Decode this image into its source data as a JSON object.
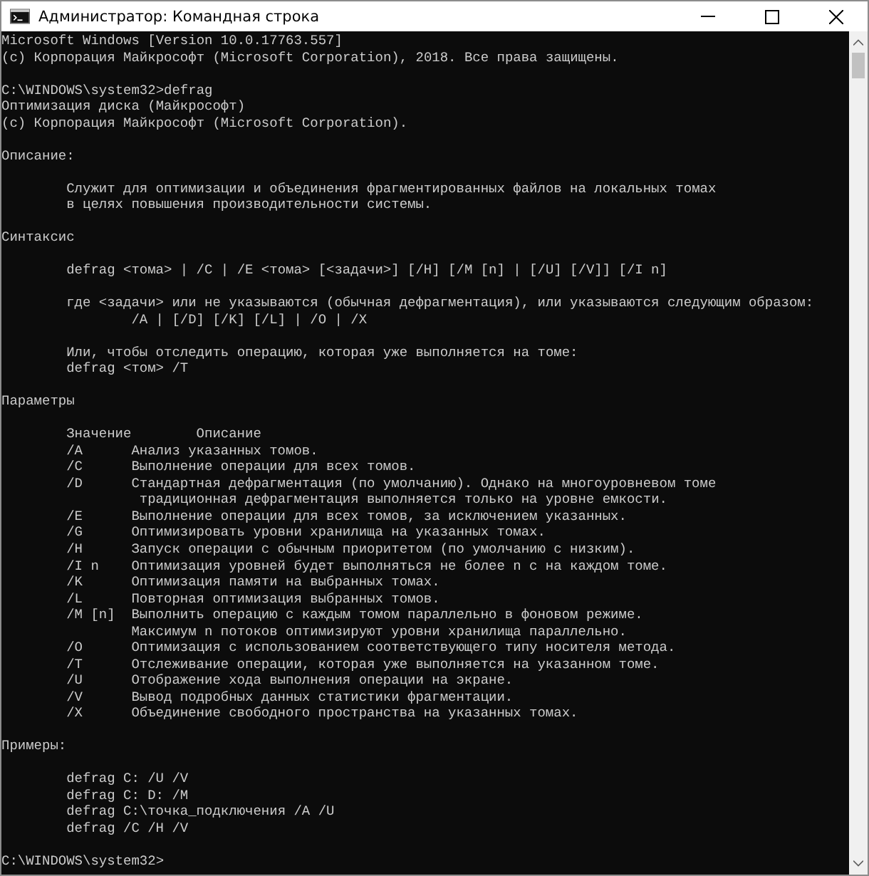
{
  "window": {
    "title": "Администратор: Командная строка",
    "buttons": [
      {
        "kind": "minimize"
      },
      {
        "kind": "maximize"
      },
      {
        "kind": "close"
      }
    ]
  },
  "console": {
    "lines": [
      {
        "kind": "line",
        "text": "Microsoft Windows [Version 10.0.17763.557]"
      },
      {
        "kind": "line",
        "text": "(c) Корпорация Майкрософт (Microsoft Corporation), 2018. Все права защищены."
      },
      {
        "kind": "blank"
      },
      {
        "kind": "line",
        "text": "C:\\WINDOWS\\system32>defrag"
      },
      {
        "kind": "line",
        "text": "Оптимизация диска (Майкрософт)"
      },
      {
        "kind": "line",
        "text": "(c) Корпорация Майкрософт (Microsoft Corporation)."
      },
      {
        "kind": "blank"
      },
      {
        "kind": "line",
        "text": "Описание:"
      },
      {
        "kind": "blank"
      },
      {
        "kind": "indent",
        "text": "Служит для оптимизации и объединения фрагментированных файлов на локальных томах"
      },
      {
        "kind": "indent",
        "text": "в целях повышения производительности системы."
      },
      {
        "kind": "blank"
      },
      {
        "kind": "line",
        "text": "Синтаксис"
      },
      {
        "kind": "blank"
      },
      {
        "kind": "indent",
        "text": "defrag <тома> | /C | /E <тома> [<задачи>] [/H] [/M [n] | [/U] [/V]] [/I n]"
      },
      {
        "kind": "blank"
      },
      {
        "kind": "indent",
        "text": "где <задачи> или не указываются (обычная дефрагментация), или указываются следующим образом:"
      },
      {
        "kind": "indent2",
        "text": "/A | [/D] [/K] [/L] | /O | /X"
      },
      {
        "kind": "blank"
      },
      {
        "kind": "indent",
        "text": "Или, чтобы отследить операцию, которая уже выполняется на томе:"
      },
      {
        "kind": "indent",
        "text": "defrag <том> /T"
      },
      {
        "kind": "blank"
      },
      {
        "kind": "line",
        "text": "Параметры"
      },
      {
        "kind": "blank"
      },
      {
        "kind": "header",
        "key": "Значение",
        "description": "Описание"
      },
      {
        "kind": "param",
        "key": "/A",
        "description": "Анализ указанных томов."
      },
      {
        "kind": "param",
        "key": "/C",
        "description": "Выполнение операции для всех томов."
      },
      {
        "kind": "param",
        "key": "/D",
        "description": "Стандартная дефрагментация (по умолчанию). Однако на многоуровневом томе"
      },
      {
        "kind": "wrap",
        "text": "традиционная дефрагментация выполняется только на уровне емкости."
      },
      {
        "kind": "param",
        "key": "/E",
        "description": "Выполнение операции для всех томов, за исключением указанных."
      },
      {
        "kind": "param",
        "key": "/G",
        "description": "Оптимизировать уровни хранилища на указанных томах."
      },
      {
        "kind": "param",
        "key": "/H",
        "description": "Запуск операции с обычным приоритетом (по умолчанию с низким)."
      },
      {
        "kind": "param",
        "key": "/I n",
        "description": "Оптимизация уровней будет выполняться не более n с на каждом томе."
      },
      {
        "kind": "param",
        "key": "/K",
        "description": "Оптимизация памяти на выбранных томах."
      },
      {
        "kind": "param",
        "key": "/L",
        "description": "Повторная оптимизация выбранных томов."
      },
      {
        "kind": "param",
        "key": "/M [n]",
        "description": "Выполнить операцию с каждым томом параллельно в фоновом режиме."
      },
      {
        "kind": "indent2",
        "text": "Максимум n потоков оптимизируют уровни хранилища параллельно."
      },
      {
        "kind": "param",
        "key": "/O",
        "description": "Оптимизация с использованием соответствующего типу носителя метода."
      },
      {
        "kind": "param",
        "key": "/T",
        "description": "Отслеживание операции, которая уже выполняется на указанном томе."
      },
      {
        "kind": "param",
        "key": "/U",
        "description": "Отображение хода выполнения операции на экране."
      },
      {
        "kind": "param",
        "key": "/V",
        "description": "Вывод подробных данных статистики фрагментации."
      },
      {
        "kind": "param",
        "key": "/X",
        "description": "Объединение свободного пространства на указанных томах."
      },
      {
        "kind": "blank"
      },
      {
        "kind": "line",
        "text": "Примеры:"
      },
      {
        "kind": "blank"
      },
      {
        "kind": "indent",
        "text": "defrag C: /U /V"
      },
      {
        "kind": "indent",
        "text": "defrag C: D: /M"
      },
      {
        "kind": "indent",
        "text": "defrag C:\\точка_подключения /A /U"
      },
      {
        "kind": "indent",
        "text": "defrag /C /H /V"
      },
      {
        "kind": "blank"
      },
      {
        "kind": "line",
        "text": "C:\\WINDOWS\\system32>"
      }
    ]
  }
}
